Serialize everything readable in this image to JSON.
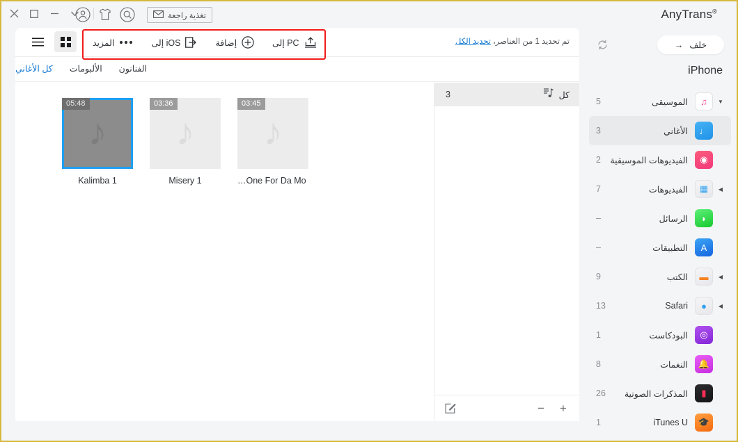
{
  "app": {
    "title": "AnyTrans",
    "title_sup": "®"
  },
  "titlebar": {
    "controls": [
      {
        "name": "close",
        "glyph": "✕"
      },
      {
        "name": "maximize",
        "glyph": "□"
      },
      {
        "name": "minimize",
        "glyph": "−"
      },
      {
        "name": "chevron-down",
        "glyph": "⌄"
      }
    ],
    "icons": [
      {
        "name": "account-icon"
      },
      {
        "name": "skin-icon"
      },
      {
        "name": "search-icon"
      }
    ],
    "feedback_label": "تغذية راجعة"
  },
  "sidebar": {
    "back_label": "خلف",
    "back_arrow": "→",
    "refresh_name": "refresh-icon",
    "device": "iPhone",
    "items": [
      {
        "label": "الموسيقى",
        "count": "5",
        "icon": "music-icon",
        "arrow": "▼",
        "active": false,
        "color1": "#ffffff",
        "color2": "#ffffff",
        "glyph": "♫",
        "glyph_color": "#ef4f9a"
      },
      {
        "label": "الأغاني",
        "count": "3",
        "icon": "songs-icon",
        "arrow": "",
        "active": true,
        "color1": "#47b3f5",
        "color2": "#1f92e8",
        "glyph": "♩",
        "glyph_color": "#ffffff"
      },
      {
        "label": "الفيديوهات الموسيقية",
        "count": "2",
        "icon": "music-videos-icon",
        "arrow": "",
        "active": false,
        "color1": "#fc5c7d",
        "color2": "#f2387a",
        "glyph": "◉",
        "glyph_color": "#ffffff"
      },
      {
        "label": "الفيديوهات",
        "count": "7",
        "icon": "videos-icon",
        "arrow": "◀",
        "active": false,
        "color1": "#f5f5f7",
        "color2": "#e8e8ec",
        "glyph": "▦",
        "glyph_color": "#3ba7f0"
      },
      {
        "label": "الرسائل",
        "count": "–",
        "icon": "messages-icon",
        "arrow": "",
        "active": false,
        "color1": "#5ef07a",
        "color2": "#16c92e",
        "glyph": "◗",
        "glyph_color": "#ffffff"
      },
      {
        "label": "التطبيقات",
        "count": "–",
        "icon": "apps-icon",
        "arrow": "",
        "active": false,
        "color1": "#3da5f5",
        "color2": "#1565e0",
        "glyph": "A",
        "glyph_color": "#ffffff"
      },
      {
        "label": "الكتب",
        "count": "9",
        "icon": "books-icon",
        "arrow": "◀",
        "active": false,
        "color1": "#f5f5f7",
        "color2": "#e8e8ec",
        "glyph": "▬",
        "glyph_color": "#f58220"
      },
      {
        "label": "Safari",
        "count": "13",
        "icon": "safari-icon",
        "arrow": "◀",
        "active": false,
        "color1": "#f5f5f7",
        "color2": "#e8e8ec",
        "glyph": "●",
        "glyph_color": "#2fa2f0"
      },
      {
        "label": "البودكاست",
        "count": "1",
        "icon": "podcasts-icon",
        "arrow": "",
        "active": false,
        "color1": "#b052f0",
        "color2": "#8326d6",
        "glyph": "◎",
        "glyph_color": "#ffffff"
      },
      {
        "label": "النغمات",
        "count": "8",
        "icon": "ringtones-icon",
        "arrow": "",
        "active": false,
        "color1": "#e85ef5",
        "color2": "#c62de0",
        "glyph": "🔔",
        "glyph_color": "#ffffff"
      },
      {
        "label": "المذكرات الصوتية",
        "count": "26",
        "icon": "voice-memos-icon",
        "arrow": "",
        "active": false,
        "color1": "#2c2c2e",
        "color2": "#151517",
        "glyph": "▮",
        "glyph_color": "#ff2d55"
      },
      {
        "label": "iTunes U",
        "count": "1",
        "icon": "itunes-u-icon",
        "arrow": "",
        "active": false,
        "color1": "#ff9f40",
        "color2": "#f56a10",
        "glyph": "🎓",
        "glyph_color": "#ffffff"
      }
    ]
  },
  "toolbar": {
    "view_modes": [
      {
        "name": "list-view",
        "active": false
      },
      {
        "name": "grid-view",
        "active": true
      }
    ],
    "actions": [
      {
        "label": "إلى PC",
        "icon": "export-to-pc-icon"
      },
      {
        "label": "إضافة",
        "icon": "plus-circle-icon"
      },
      {
        "label": "إلى iOS",
        "icon": "import-to-ios-icon"
      },
      {
        "label": "المزيد",
        "icon": "more-dots-icon"
      }
    ]
  },
  "selection": {
    "prefix": "تم تحديد 1 من العناصر، ",
    "link": "تحديد الكل"
  },
  "tabs": [
    {
      "label": "كل الأغاني",
      "active": true
    },
    {
      "label": "الألبومات",
      "active": false
    },
    {
      "label": "الفنانون",
      "active": false
    }
  ],
  "songs": [
    {
      "title": "…One For Da Mo 1",
      "duration": "03:45",
      "selected": false
    },
    {
      "title": "Misery 1",
      "duration": "03:36",
      "selected": false
    },
    {
      "title": "Kalimba 1",
      "duration": "05:48",
      "selected": true
    }
  ],
  "playlist_panel": {
    "header_label": "كل",
    "header_count": "3",
    "header_icon": "playlist-note-icon",
    "footer_edit_icon": "edit-icon",
    "footer_minus": "−",
    "footer_plus": "+"
  }
}
